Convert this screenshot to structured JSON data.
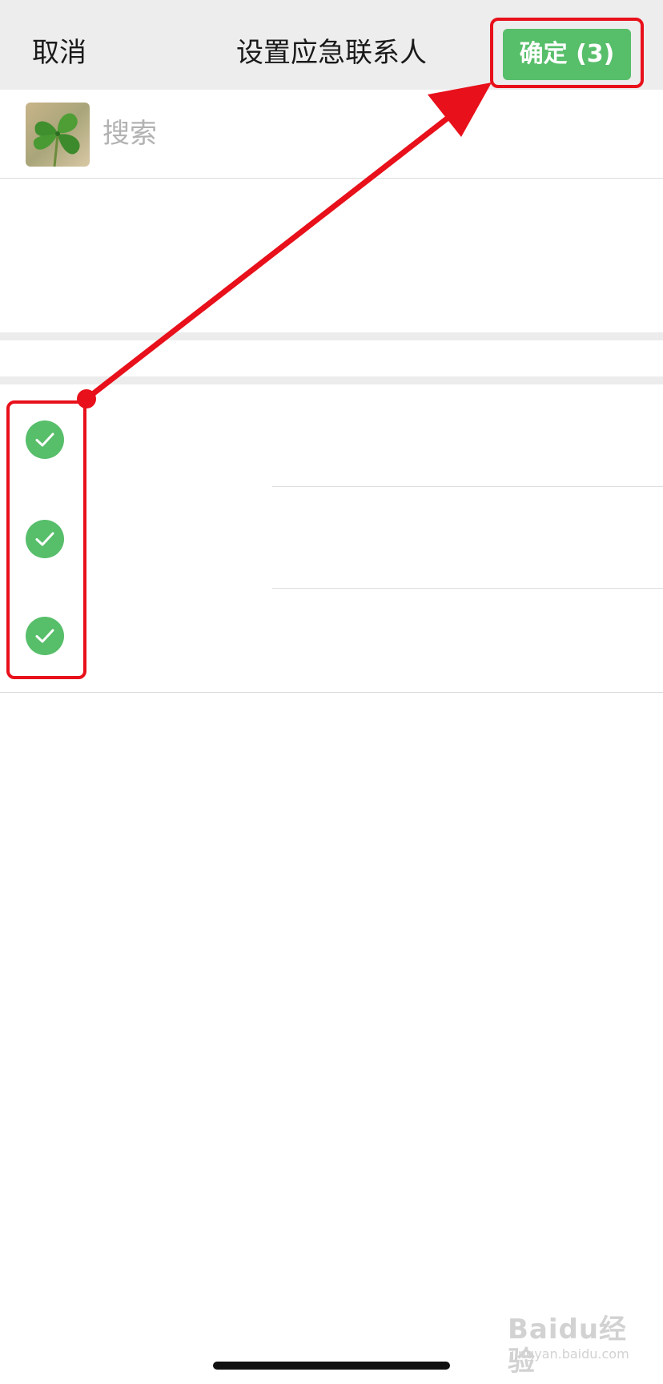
{
  "navbar": {
    "cancel_label": "取消",
    "title": "设置应急联系人",
    "confirm_label": "确定 (3)"
  },
  "search": {
    "placeholder": "搜索",
    "avatar_icon": "clover-avatar-icon"
  },
  "contacts": {
    "selected": [
      {
        "checked": true,
        "icon": "check-circle-icon"
      },
      {
        "checked": true,
        "icon": "check-circle-icon"
      },
      {
        "checked": true,
        "icon": "check-circle-icon"
      }
    ]
  },
  "watermark": {
    "main": "Baidu经验",
    "sub": "jingyan.baidu.com"
  },
  "colors": {
    "accent_green": "#57be6a",
    "annotation_red": "#e8101a",
    "navbar_bg": "#ededed",
    "placeholder_gray": "#b2b2b2"
  }
}
